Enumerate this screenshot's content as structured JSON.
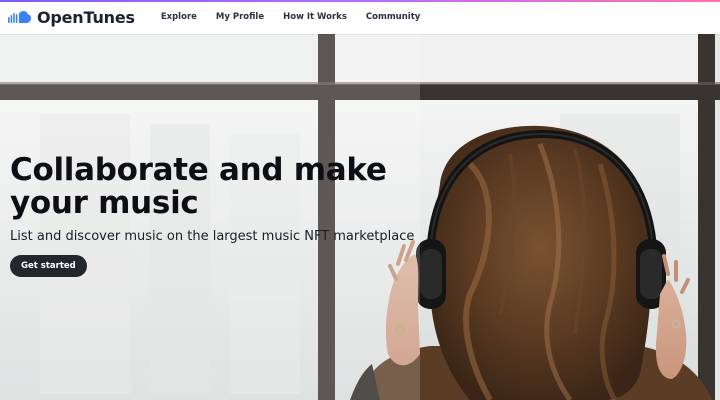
{
  "brand": {
    "name": "OpenTunes",
    "icon": "sound-wave-cloud-icon",
    "icon_color": "#3b82f6"
  },
  "nav": {
    "items": [
      {
        "label": "Explore"
      },
      {
        "label": "My Profile"
      },
      {
        "label": "How It Works"
      },
      {
        "label": "Community"
      }
    ]
  },
  "hero": {
    "title": "Collaborate and make your music",
    "subtitle": "List and discover music on the largest music NFT marketplace",
    "cta_label": "Get started",
    "image": "woman-with-headphones-at-window-photo"
  },
  "colors": {
    "accent_gradient_start": "#7c5cff",
    "accent_gradient_end": "#ff6fb1",
    "button_bg": "#23262b",
    "title_text": "#0d0f14"
  }
}
